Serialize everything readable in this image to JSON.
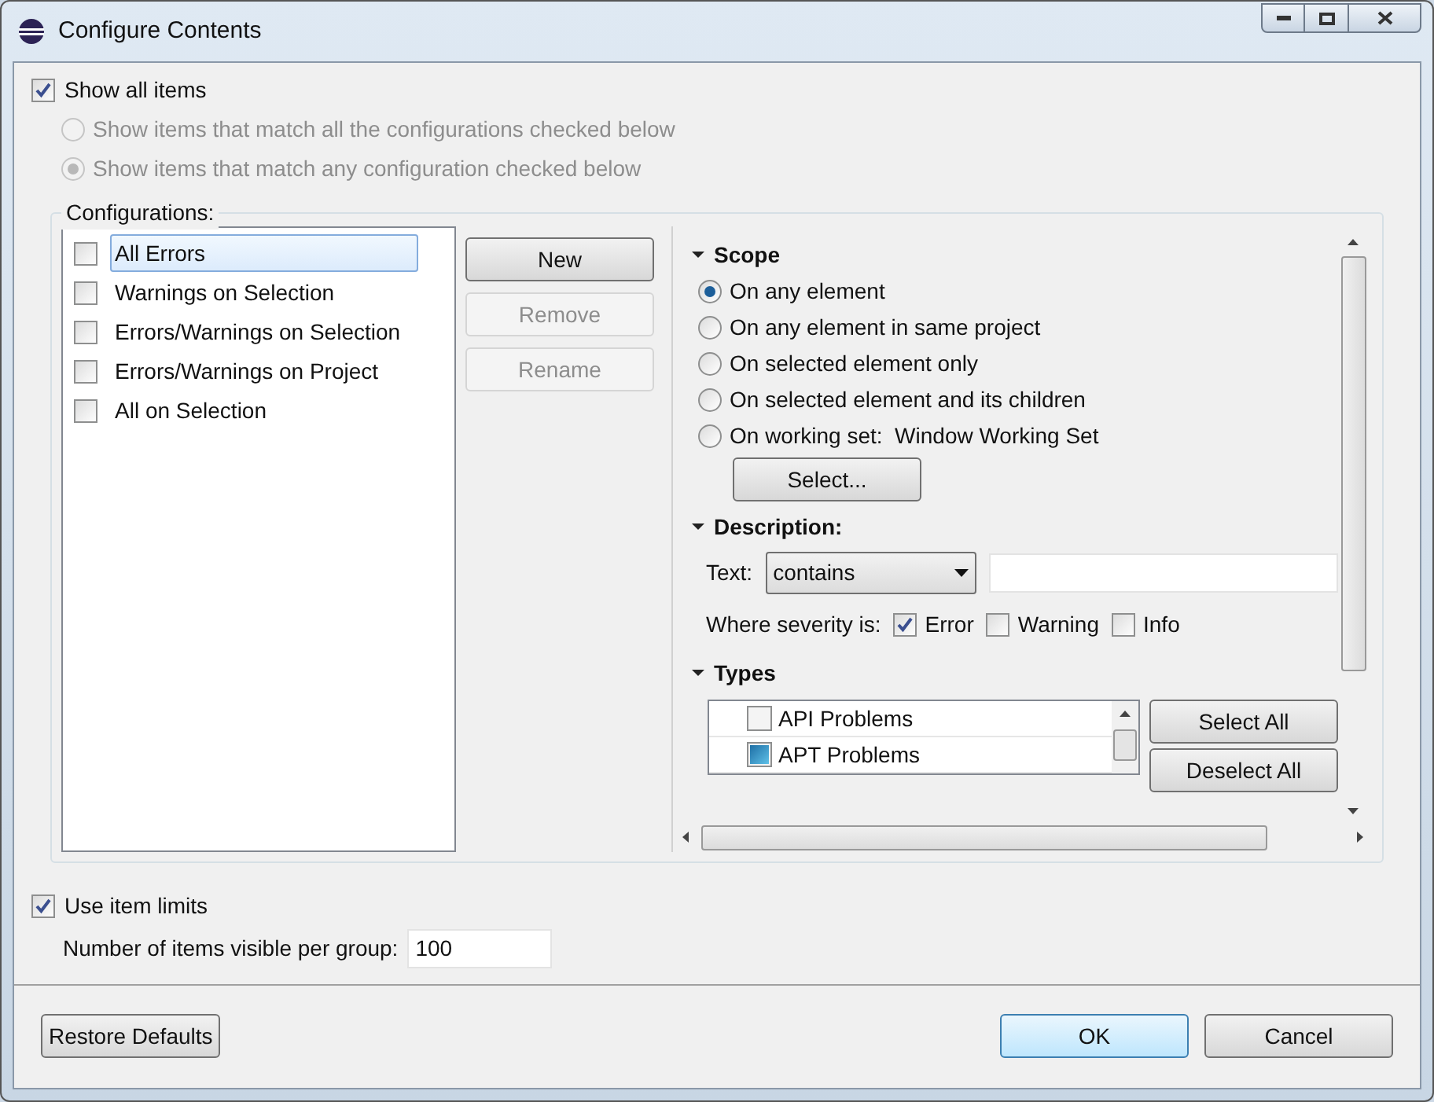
{
  "window": {
    "title": "Configure Contents"
  },
  "show_all": {
    "label": "Show all items",
    "checked": true
  },
  "match_options": [
    {
      "label": "Show items that match all the configurations checked below",
      "selected": false,
      "disabled": true
    },
    {
      "label": "Show items that match any configuration checked below",
      "selected": true,
      "disabled": true
    }
  ],
  "configurations": {
    "title": "Configurations:",
    "items": [
      {
        "label": "All Errors",
        "checked": false,
        "selected": true
      },
      {
        "label": "Warnings on Selection",
        "checked": false,
        "selected": false
      },
      {
        "label": "Errors/Warnings on Selection",
        "checked": false,
        "selected": false
      },
      {
        "label": "Errors/Warnings on Project",
        "checked": false,
        "selected": false
      },
      {
        "label": "All on Selection",
        "checked": false,
        "selected": false
      }
    ],
    "buttons": [
      {
        "label": "New",
        "disabled": false
      },
      {
        "label": "Remove",
        "disabled": true
      },
      {
        "label": "Rename",
        "disabled": true
      }
    ]
  },
  "scope": {
    "title": "Scope",
    "expanded": true,
    "options": [
      {
        "label": "On any element",
        "selected": true
      },
      {
        "label": "On any element in same project",
        "selected": false
      },
      {
        "label": "On selected element only",
        "selected": false
      },
      {
        "label": "On selected element and its children",
        "selected": false
      },
      {
        "label": "On working set:  Window Working Set",
        "selected": false
      }
    ],
    "select_button": "Select..."
  },
  "description": {
    "title": "Description:",
    "expanded": true,
    "text_label": "Text:",
    "operator": "contains",
    "severity_label": "Where severity is:",
    "severities": [
      {
        "label": "Error",
        "checked": true
      },
      {
        "label": "Warning",
        "checked": false
      },
      {
        "label": "Info",
        "checked": false
      }
    ]
  },
  "types": {
    "title": "Types",
    "expanded": true,
    "items": [
      {
        "label": "API Problems",
        "mixed": false
      },
      {
        "label": "APT Problems",
        "mixed": true
      }
    ],
    "buttons": [
      "Select All",
      "Deselect All"
    ]
  },
  "item_limits": {
    "label": "Use item limits",
    "checked": true,
    "count_label": "Number of items visible per group:",
    "count_value": "100"
  },
  "footer": {
    "restore": "Restore Defaults",
    "ok": "OK",
    "cancel": "Cancel"
  }
}
